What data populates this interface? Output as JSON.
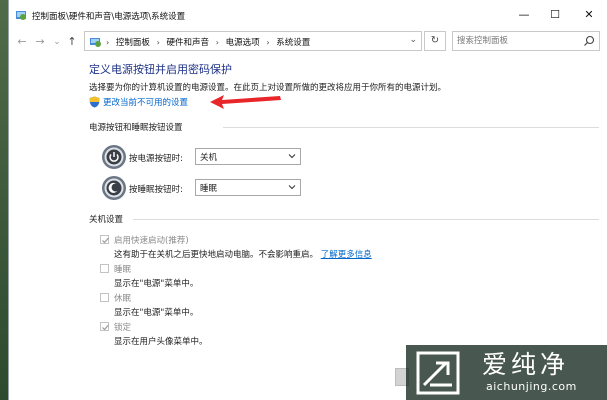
{
  "window": {
    "title": "控制面板\\硬件和声音\\电源选项\\系统设置",
    "minimize": "—",
    "maximize": "☐",
    "close": "✕"
  },
  "addressbar": {
    "back": "←",
    "forward": "→",
    "recent": "⌄",
    "up": "↑",
    "crumbs": [
      "控制面板",
      "硬件和声音",
      "电源选项",
      "系统设置"
    ],
    "crumb_sep": "›",
    "dropdown": "⌄",
    "refresh": "↻",
    "search_placeholder": "搜索控制面板"
  },
  "main": {
    "title": "定义电源按钮并启用密码保护",
    "description": "选择要为你的计算机设置的电源设置。在此页上对设置所做的更改将应用于你所有的电源计划。",
    "change_link": "更改当前不可用的设置",
    "power_group_title": "电源按钮和睡眠按钮设置",
    "power_rows": [
      {
        "label": "按电源按钮时:",
        "value": "关机"
      },
      {
        "label": "按睡眠按钮时:",
        "value": "睡眠"
      }
    ],
    "shutdown_group_title": "关机设置",
    "shutdown_items": [
      {
        "label": "启用快速启动(推荐)",
        "checked": true,
        "desc": "这有助于在关机之后更快地启动电脑。不会影响重启。",
        "link": "了解更多信息"
      },
      {
        "label": "睡眠",
        "checked": false,
        "desc": "显示在\"电源\"菜单中。",
        "link": ""
      },
      {
        "label": "休眠",
        "checked": false,
        "desc": "显示在\"电源\"菜单中。",
        "link": ""
      },
      {
        "label": "锁定",
        "checked": true,
        "desc": "显示在用户头像菜单中。",
        "link": ""
      }
    ]
  },
  "watermark": {
    "brand": "爱纯净",
    "url": "aichunjing.com"
  },
  "colors": {
    "title_blue": "#1e3287",
    "link_blue": "#0066cc",
    "arrow_red": "#e8262a"
  }
}
